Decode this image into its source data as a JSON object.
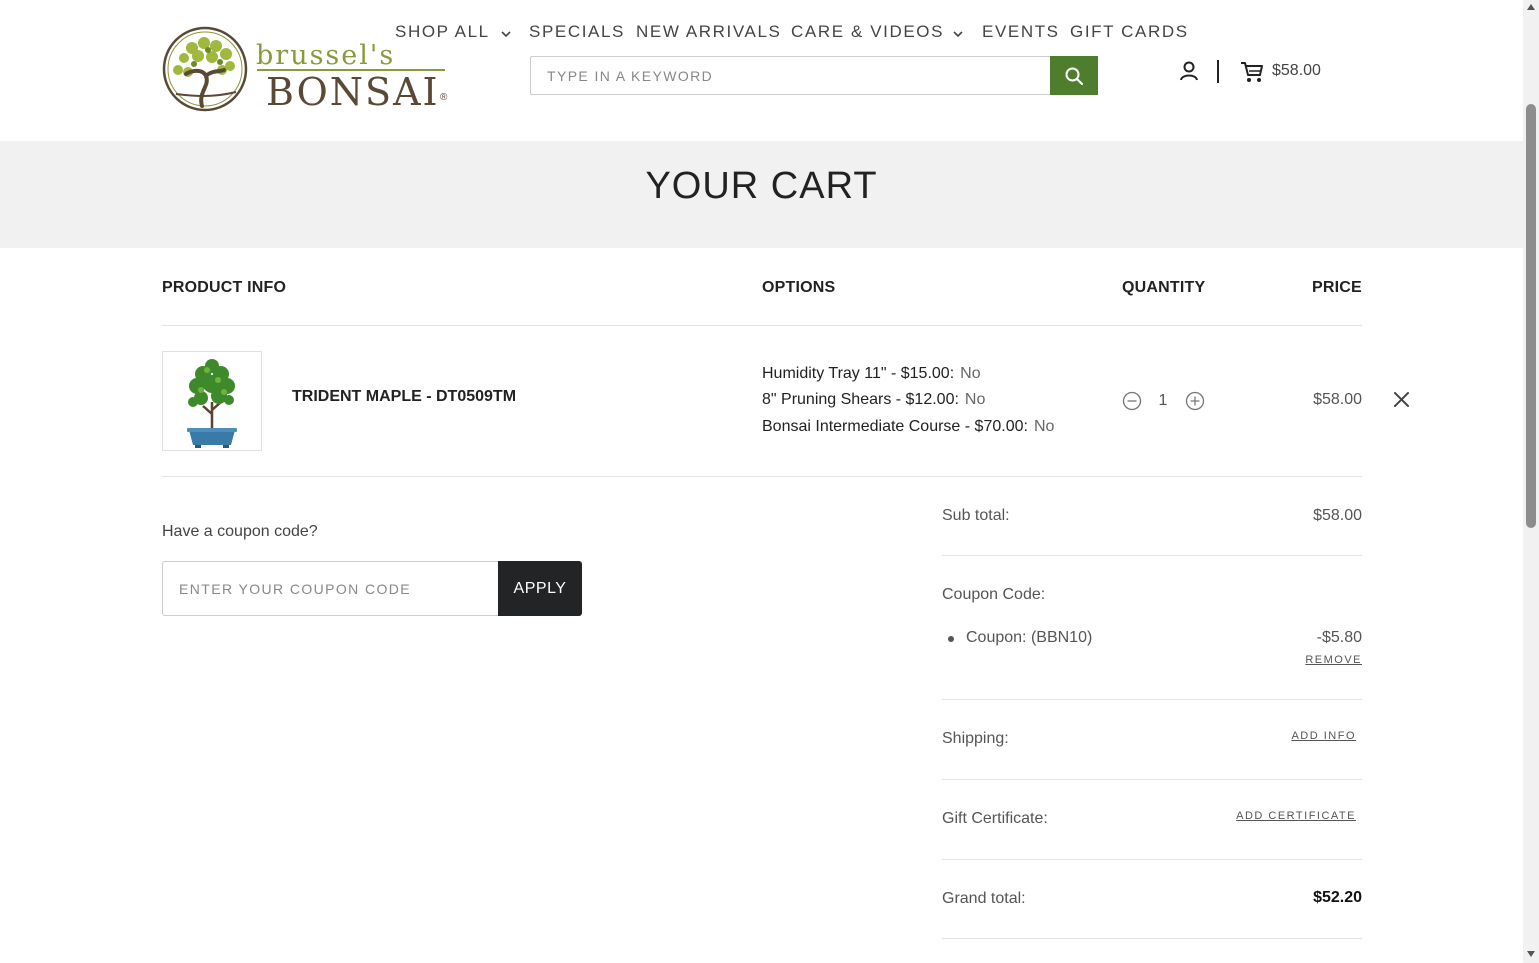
{
  "header": {
    "logo": {
      "top": "brussel's",
      "bottom": "BONSAI",
      "reg": "®"
    },
    "nav": {
      "shop_all": "SHOP ALL",
      "specials": "SPECIALS",
      "new_arrivals": "NEW ARRIVALS",
      "care_videos": "CARE & VIDEOS",
      "events": "EVENTS",
      "gift_cards": "GIFT CARDS"
    },
    "search_placeholder": "TYPE IN A KEYWORD",
    "cart_total": "$58.00"
  },
  "page_title": "YOUR CART",
  "table": {
    "headers": {
      "product": "PRODUCT INFO",
      "options": "OPTIONS",
      "quantity": "QUANTITY",
      "price": "PRICE"
    },
    "item": {
      "name": "TRIDENT MAPLE - DT0509TM",
      "options": [
        {
          "label": "Humidity Tray 11\" - $15.00:",
          "value": "No"
        },
        {
          "label": "8\" Pruning Shears - $12.00:",
          "value": "No"
        },
        {
          "label": "Bonsai Intermediate Course - $70.00:",
          "value": "No"
        }
      ],
      "quantity": "1",
      "price": "$58.00"
    }
  },
  "coupon": {
    "question": "Have a coupon code?",
    "placeholder": "ENTER YOUR COUPON CODE",
    "apply": "APPLY"
  },
  "totals": {
    "subtotal_label": "Sub total:",
    "subtotal_value": "$58.00",
    "coupon_label": "Coupon Code:",
    "coupon_line": "Coupon: (BBN10)",
    "coupon_value": "-$5.80",
    "coupon_remove": "REMOVE",
    "shipping_label": "Shipping:",
    "shipping_link": "ADD INFO",
    "gift_label": "Gift Certificate:",
    "gift_link": "ADD CERTIFICATE",
    "grand_label": "Grand total:",
    "grand_value": "$52.20"
  },
  "colors": {
    "brand_green": "#4f7d2e",
    "logo_olive": "#8a9a3b",
    "logo_brown": "#5a4a35",
    "apply_button": "#222426",
    "banner_bg": "#f1f1f1"
  }
}
